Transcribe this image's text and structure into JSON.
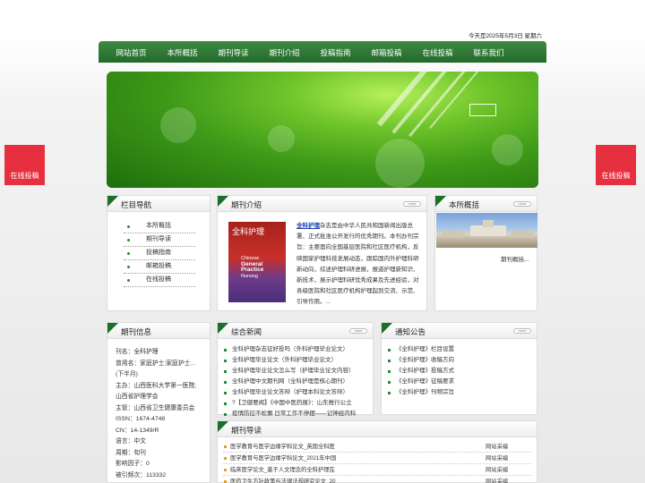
{
  "date_text": "今天是2025年5月3日 星期六",
  "nav": [
    "网站首页",
    "本所概括",
    "期刊导读",
    "期刊介绍",
    "投稿指南",
    "邮箱投稿",
    "在线投稿",
    "联系我们"
  ],
  "side_buttons": {
    "left": "在线投稿",
    "right": "在线投稿"
  },
  "more_label": "more",
  "column_nav": {
    "title": "栏目导航",
    "items": [
      "本所概括",
      "期刊导读",
      "投稿指南",
      "邮箱投稿",
      "在线投稿"
    ]
  },
  "journal_intro": {
    "title": "期刊介绍",
    "cover_title": "全科护理",
    "cover_en_1": "Chinese",
    "cover_en_2": "General Practice",
    "cover_en_3": "Nursing",
    "link": "全科护理",
    "text": "杂志是由中华人民共和国新闻出版总署、正式批准公开发行的优秀期刊。本刊办刊宗旨：主要面向全国基层医院和社区医疗机构，反映国家护理科技发展动态，跟踪国内外护理科研新动向，综述护理科研进展，报道护理新知识、新技术，展示护理科研优秀成果及先进经验，对各级医院和社区医疗机构护理起到交流、示范、引导作用。..."
  },
  "about": {
    "title": "本所概括",
    "caption": "期刊概括..."
  },
  "journal_info": {
    "title": "期刊信息",
    "lines": [
      "刊名：全科护理",
      "曾用名：家庭护士;家庭护士...",
      "(下半月)",
      "主办：山西医科大学第一医院;",
      "山西省护理学会",
      "主管：山西省卫生健康委员会",
      "ISSN：1674-4748",
      "CN：14-1349/R",
      "语言：中文",
      "周期：旬刊",
      "影响因子：0",
      "被引频次：113332"
    ]
  },
  "news": {
    "title": "综合新闻",
    "items": [
      "全科护理杂志征好投吗（外科护理毕业论文）",
      "全科护理毕业论文（外科护理毕业论文）",
      "全科护理毕业论文怎么写（护理毕业论文内容）",
      "全科护理中文期刊网（全科护理是核心期刊）",
      "全科护理毕业论文答辩（护理本科论文答辩）",
      "?【卫健要闻】《中国中医药报》：山东推行公立",
      "疫情防控不松懈 日常工作不停摆——记神经内科"
    ]
  },
  "notice": {
    "title": "通知公告",
    "items": [
      "《全科护理》栏目设置",
      "《全科护理》收稿方向",
      "《全科护理》投稿方式",
      "《全科护理》征稿要求",
      "《全科护理》刊物宗旨"
    ]
  },
  "guide": {
    "title": "期刊导读",
    "rows": [
      {
        "title": "医学教育与医学边缘学科论文_英国全科医",
        "source": "网站采编"
      },
      {
        "title": "医学教育与医学边缘学科论文_2021年中国",
        "source": "网站采编"
      },
      {
        "title": "临床医学论文_基于人文理念的全科护理在",
        "source": "网站采编"
      },
      {
        "title": "医药卫生方针政策与法律法规研究论文_20",
        "source": "网站采编"
      }
    ]
  }
}
